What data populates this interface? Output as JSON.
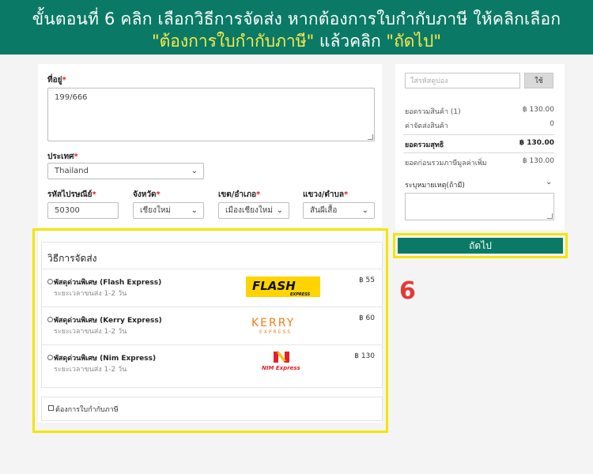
{
  "banner": {
    "line1": "ขั้นตอนที่ 6      คลิก เลือกวิธีการจัดส่ง หากต้องการใบกำกับภาษี ให้คลิกเลือก",
    "line2_q1": "\"ต้องการใบกำกับภาษี\"",
    "line2_mid": " แล้วคลิก ",
    "line2_q2": "\"ถัดไป\""
  },
  "address": {
    "label": "ที่อยู่",
    "value": "199/666"
  },
  "country": {
    "label": "ประเทศ",
    "value": "Thailand"
  },
  "postal": {
    "label": "รหัสไปรษณีย์",
    "value": "50300"
  },
  "province": {
    "label": "จังหวัด",
    "value": "เชียงใหม่"
  },
  "district": {
    "label": "เขต/อำเภอ",
    "value": "เมืองเชียงใหม่"
  },
  "subdistrict": {
    "label": "แขวง/ตำบล",
    "value": "สันผีเสื้อ"
  },
  "required_mark": "*",
  "shipping": {
    "title": "วิธีการจัดส่ง",
    "options": [
      {
        "name": "พัสดุด่วนพิเศษ (Flash Express)",
        "duration": "ระยะเวลาขนส่ง  1-2  วัน",
        "price": "฿ 55",
        "logo": "flash-express-logo",
        "logo_text": "FLASH",
        "logo_sub": "EXPRESS"
      },
      {
        "name": "พัสดุด่วนพิเศษ (Kerry Express)",
        "duration": "ระยะเวลาขนส่ง  1-2  วัน",
        "price": "฿ 60",
        "logo": "kerry-express-logo",
        "logo_text": "KERRY",
        "logo_sub": "EXPRESS"
      },
      {
        "name": "พัสดุด่วนพิเศษ (Nim Express)",
        "duration": "ระยะเวลาขนส่ง  1-2  วัน",
        "price": "฿ 130",
        "logo": "nim-express-logo",
        "logo_text": "NIM Express",
        "logo_sub": ""
      }
    ]
  },
  "tax_invoice": {
    "label": "ต้องการใบกำกับภาษี",
    "checked": false
  },
  "summary": {
    "coupon_placeholder": "ใส่รหัสคูปอง",
    "use_button": "ใช้",
    "subtotal_label": "ยอดรวมสินค้า (1)",
    "subtotal_value": "฿ 130.00",
    "shipping_label": "ค่าจัดส่งสินค้า",
    "shipping_value": "0",
    "net_label": "ยอดรวมสุทธิ",
    "net_value": "฿ 130.00",
    "vat_label": "ยอดก่อนรวมภาษีมูลค่าเพิ่ม",
    "vat_value": "฿ 130.00",
    "notes_label": "ระบุหมายเหตุ(ถ้ามี)"
  },
  "next_button": "ถัดไป",
  "step_number": "6",
  "colors": {
    "brand": "#0a7a66",
    "highlight": "#f2e600",
    "step": "#e53935",
    "required": "#e02020"
  }
}
